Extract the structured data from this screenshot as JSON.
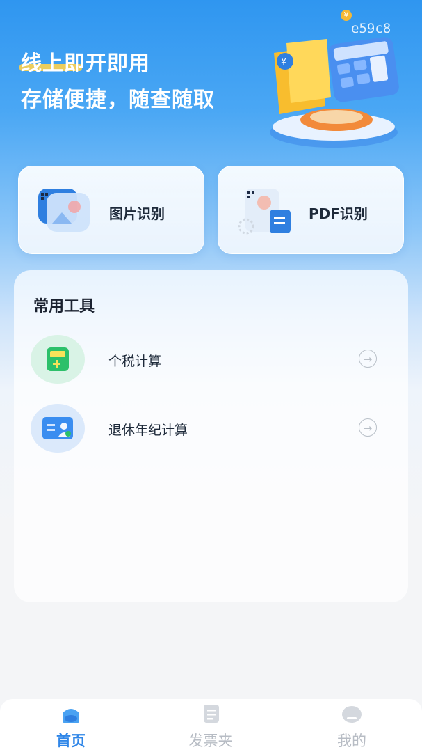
{
  "hero": {
    "line1": "线上即开即用",
    "line2": "存储便捷，随查随取",
    "watermark": "e59c8"
  },
  "feature_cards": [
    {
      "label": "图片识别",
      "icon": "image-recognition-icon"
    },
    {
      "label": "PDF识别",
      "icon": "pdf-recognition-icon"
    }
  ],
  "tools": {
    "title": "常用工具",
    "items": [
      {
        "label": "个税计算",
        "icon": "tax-calculator-icon"
      },
      {
        "label": "退休年纪计算",
        "icon": "retirement-card-icon"
      }
    ]
  },
  "tabbar": {
    "items": [
      {
        "label": "首页",
        "icon": "home-icon",
        "active": true
      },
      {
        "label": "发票夹",
        "icon": "invoice-folder-icon",
        "active": false
      },
      {
        "label": "我的",
        "icon": "profile-icon",
        "active": false
      }
    ],
    "active_color": "#2f86e8",
    "inactive_color": "#b7bcc4"
  },
  "colors": {
    "accent": "#2f96f0",
    "highlight": "#ffd24d"
  }
}
